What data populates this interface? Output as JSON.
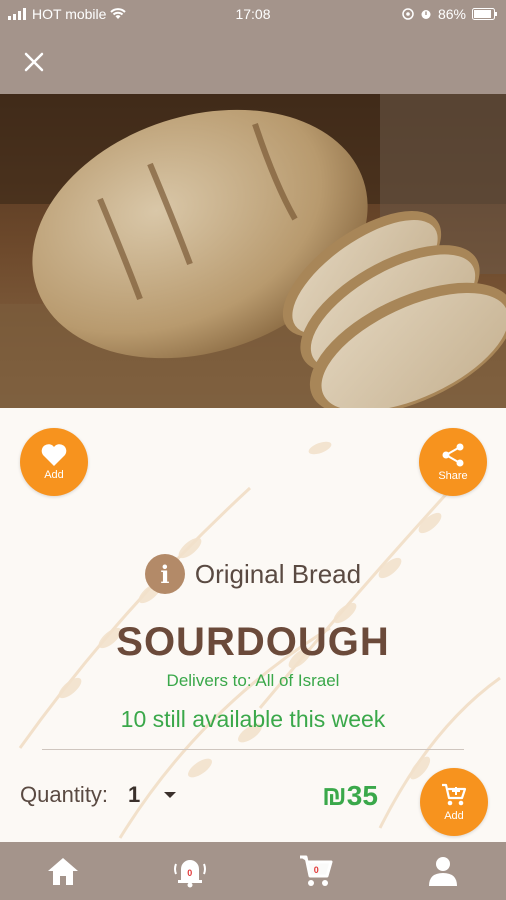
{
  "status_bar": {
    "carrier": "HOT mobile",
    "time": "17:08",
    "battery": "86%"
  },
  "product": {
    "category": "Original Bread",
    "name": "SOURDOUGH",
    "delivers": "Delivers to: All of Israel",
    "availability": "10 still available this week",
    "quantity_label": "Quantity:",
    "quantity_value": "1",
    "price": "₪35"
  },
  "actions": {
    "favorite_label": "Add",
    "share_label": "Share",
    "cart_label": "Add"
  },
  "bottom_nav": {
    "notifications_count": "0",
    "cart_count": "0"
  },
  "colors": {
    "accent": "#f7931e",
    "brown_bar": "#a4948b",
    "green": "#3aa84a",
    "title": "#6b4a3a"
  },
  "icons": [
    "close-icon",
    "heart-icon",
    "share-icon",
    "info-icon",
    "cart-icon",
    "home-icon",
    "bell-icon",
    "user-icon"
  ]
}
